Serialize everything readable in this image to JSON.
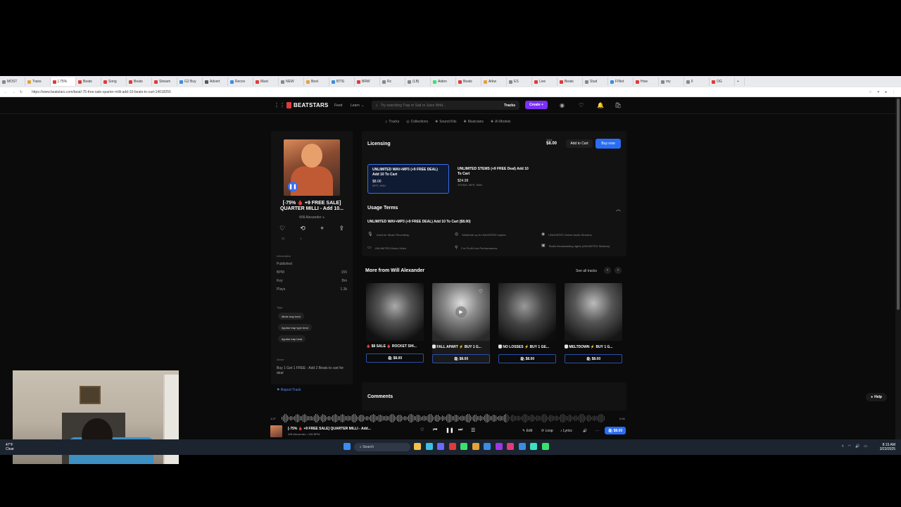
{
  "browser": {
    "tabs": [
      "MOST",
      "Trans",
      "[-75%",
      "Beats",
      "Song",
      "Beats",
      "Stream",
      "G2 Buy",
      "Advert",
      "Recov",
      "Mast",
      "NEW",
      "Best",
      "BTIS",
      "BRW",
      "Rc",
      "(LB)",
      "Aiden",
      "Beats",
      "Arkw",
      "ES",
      "Live",
      "Beats",
      "Stud",
      "F/Not",
      "How",
      "my",
      "Il",
      "OG"
    ],
    "url": "https://www.beatstars.com/beat/-75-free-sale-quarter-milli-add-10-beats-to-cart-14018255"
  },
  "header": {
    "brand": "BEATSTARS",
    "feed": "Feed",
    "learn": "Learn",
    "search_placeholder": "Try searching Trap or Sad or Juice Wrld...",
    "search_scope": "Tracks",
    "create": "Create +",
    "subnav": [
      {
        "icon": "♫",
        "label": "Tracks"
      },
      {
        "icon": "◎",
        "label": "Collections"
      },
      {
        "icon": "✚",
        "label": "Sound Kits"
      },
      {
        "icon": "✚",
        "label": "Musicians"
      },
      {
        "icon": "✚",
        "label": "AI Models"
      }
    ]
  },
  "track": {
    "title": "[-75% 🩸 +9 FREE SALE] QUARTER MILLI - Add 10...",
    "artist": "Will Alexander",
    "likes": "21",
    "reposts": "1",
    "info_heading": "Information",
    "info": [
      {
        "k": "Published",
        "v": ""
      },
      {
        "k": "BPM",
        "v": "155"
      },
      {
        "k": "Key",
        "v": "Bm"
      },
      {
        "k": "Plays",
        "v": "1.3k"
      }
    ],
    "tags_heading": "Tags",
    "tags": [
      "#flute trap beat",
      "#guitar trap type beat",
      "#guitar trap beat"
    ],
    "about_heading": "About",
    "about": "Buy 1 Get 1 FREE - Add 2 Beats to cart for deal",
    "report": "Report Track"
  },
  "licensing": {
    "title": "Licensing",
    "total_label": "Total",
    "total": "$8.00",
    "add_to_cart": "Add to Cart",
    "buy_now": "Buy now",
    "options": [
      {
        "title": "UNLIMITED WAV+MP3 (+9 FREE DEAL) Add 10 To Cart",
        "price": "$8.00",
        "formats": "MP3, WAV"
      },
      {
        "title": "UNLIMITED STEMS (+9 FREE Deal) Add 10 To Cart",
        "price": "$24.99",
        "formats": "STEMS, MP3, WAV"
      }
    ],
    "usage_title": "Usage Terms",
    "usage_sub": "UNLIMITED WAV+MP3 (+9 FREE DEAL) Add 10 To Cart ($8.00)",
    "terms": [
      "Used for Music Recording",
      "Distribute up to UNLIMITED copies",
      "UNLIMITED Online Audio Streams",
      "UNLIMITED Music Video",
      "For Profit Live Performances",
      "Radio Broadcasting rights (UNLIMITED Stations)"
    ]
  },
  "more": {
    "title": "More from Will Alexander",
    "see_all": "See all tracks",
    "beats": [
      {
        "title": "🩸 $8 SALE 🩸 ROCKET SHI...",
        "price": "$8.00"
      },
      {
        "title": "🅰 FALL APART ⚡ BUY 1 G...",
        "price": "$8.00"
      },
      {
        "title": "🅰 NO LOSSES ⚡ BUY 1 GE...",
        "price": "$8.00"
      },
      {
        "title": "🅰 MELTDOWN ⚡ BUY 1 G...",
        "price": "$8.00"
      }
    ]
  },
  "comments": {
    "title": "Comments"
  },
  "help": "Help",
  "player": {
    "elapsed": "1:27",
    "duration": "2:04",
    "title": "[-75% 🩸 +9 FREE SALE] QUARTER MILLI - Add...",
    "sub": "Will Alexander • 155 BPM",
    "edit": "Edit",
    "loop": "Loop",
    "lyrics": "Lyrics",
    "price": "$8.00"
  },
  "taskbar": {
    "weather_temp": "47°F",
    "weather_desc": "Clear",
    "search": "Search",
    "time": "8:15 AM",
    "date": "3/23/2025"
  }
}
